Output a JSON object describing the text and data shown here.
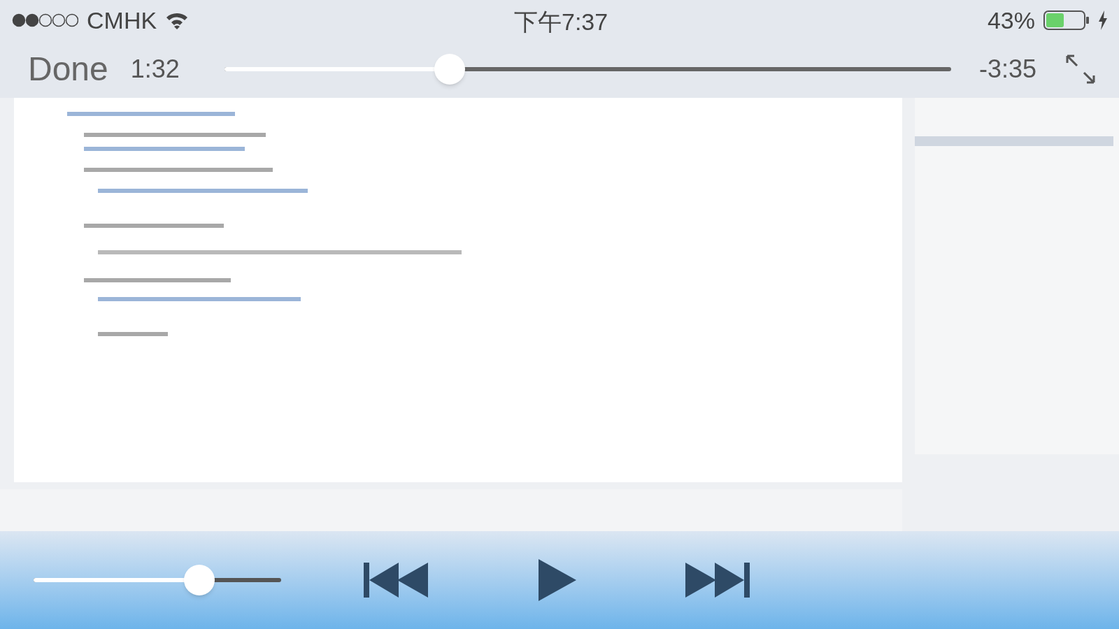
{
  "status_bar": {
    "carrier": "CMHK",
    "time": "下午7:37",
    "battery": "43%"
  },
  "player": {
    "done": "Done",
    "elapsed": "1:32",
    "remaining": "-3:35",
    "progress": {
      "level": 0.31
    }
  },
  "controls": {
    "volume": {
      "level": 0.67
    }
  }
}
